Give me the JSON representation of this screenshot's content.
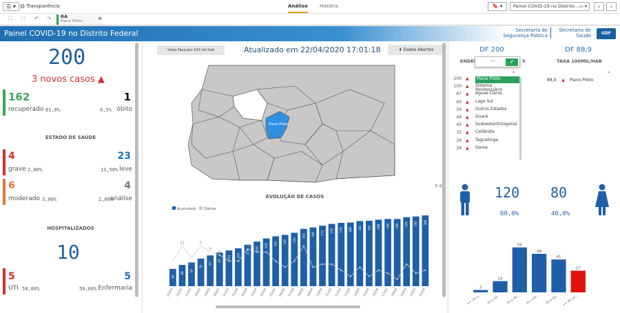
{
  "topbar": {
    "app_name": "Transparência",
    "tab_analise": "Análise",
    "tab_historia": "História",
    "sheet_title": "Painel COVID-19 no Distrito...",
    "menu_glyph": "☰ ▾",
    "bookmark_glyph": "🔖 ▾",
    "sheet_glyph": "▭ ▾",
    "prev_glyph": "‹",
    "next_glyph": "›",
    "globe_glyph": "◍"
  },
  "selection": {
    "field": "RA",
    "value": "Plano Piloto",
    "clear_glyph": "⊗",
    "tool_glyphs": [
      "⛶",
      "⬚",
      "↶",
      "↷"
    ]
  },
  "header": {
    "title": "Painel COVID-19 no Distrito Federal",
    "org1_line1": "Secretaria de",
    "org1_line2": "Segurança Pública",
    "org2_line1": "Secretaria de",
    "org2_line2": "Saúde",
    "gdf_logo": "GDF"
  },
  "left": {
    "total_cases": "200",
    "new_cases": "3 novos casos ▲",
    "recovered_value": "162",
    "recovered_label": "recuperado",
    "recovered_pct": "81,0%",
    "deaths_value": "1",
    "deaths_label": "óbito",
    "deaths_pct": "0,5%",
    "health_title": "ESTADO DE SAÚDE",
    "grave_value": "4",
    "grave_label": "grave",
    "grave_pct": "2,00%",
    "leve_value": "23",
    "leve_label": "leve",
    "leve_pct": "11,50%",
    "moderado_value": "6",
    "moderado_label": "moderado",
    "moderado_pct": "3,00%",
    "analise_value": "4",
    "analise_label": "análise",
    "analise_pct": "2,00%",
    "hosp_title": "HOSPITALIZADOS",
    "hosp_value": "10",
    "uti_value": "5",
    "uti_label": "UTI",
    "uti_pct": "50,00%",
    "enf_value": "5",
    "enf_label": "Enfermaria",
    "enf_pct": "50,00%"
  },
  "center": {
    "toggle_btn": "Visão Taxa por 100 mil hab",
    "updated": "Atualizado em 22/04/2020 17:01:18",
    "open_data_btn": "Dados Abertos",
    "download_glyph": "⬇",
    "map_label": "Plano Piloto",
    "evolution_title": "EVOLUÇÃO DE CASOS",
    "legend_acumulado": "Acumulado",
    "legend_diarios": "Diários",
    "copyright": "© Qlik"
  },
  "right": {
    "df_total": "DF 200",
    "df_rate": "DF 88,9",
    "col_endereco": "ENDER",
    "col_endereco_end": "S",
    "col_taxa": "TAXA 100MIL/HAB",
    "search_glyph": "⌕",
    "confirm_glyph": "✔",
    "more_glyph": "···",
    "list": [
      {
        "count": "200",
        "name": "Plano Piloto",
        "selected": true
      },
      {
        "count": "100",
        "name": "Sistema Penitenciário",
        "selected": false
      },
      {
        "count": "87",
        "name": "Águas Claras",
        "selected": false
      },
      {
        "count": "66",
        "name": "Lago Sul",
        "selected": false
      },
      {
        "count": "59",
        "name": "Outros Estados",
        "selected": false
      },
      {
        "count": "48",
        "name": "Guará",
        "selected": false
      },
      {
        "count": "40",
        "name": "Sudoeste/Octogonal",
        "selected": false
      },
      {
        "count": "32",
        "name": "Ceilândia",
        "selected": false
      },
      {
        "count": "26",
        "name": "Taguatinga",
        "selected": false
      },
      {
        "count": "28",
        "name": "Gama",
        "selected": false
      }
    ],
    "rate_row_value": "88,9",
    "rate_row_name": "Plano Piloto",
    "male_count": "120",
    "male_pct": "60,0%",
    "female_count": "80",
    "female_pct": "40,0%"
  },
  "chart_data": [
    {
      "type": "bar",
      "title": "EVOLUÇÃO DE CASOS",
      "series": [
        {
          "name": "Acumulado",
          "type": "bar",
          "color": "#1f5fa8",
          "values": [
            49,
            60,
            67,
            78,
            87,
            95,
            101,
            107,
            117,
            126,
            135,
            141,
            145,
            151,
            162,
            166,
            171,
            176,
            179,
            180,
            184,
            185,
            188,
            190,
            190,
            195,
            197,
            200
          ]
        },
        {
          "name": "Diários",
          "type": "line",
          "color": "#cccccc",
          "values": [
            6,
            11,
            7,
            11,
            9,
            8,
            6,
            6,
            10,
            9,
            9,
            6,
            4,
            6,
            11,
            4,
            5,
            5,
            3,
            1,
            4,
            1,
            3,
            2,
            0,
            5,
            2,
            3
          ]
        }
      ],
      "categories": [
        "25/03",
        "26/03",
        "27/03",
        "28/03",
        "29/03",
        "30/03",
        "31/03",
        "01/04",
        "02/04",
        "03/04",
        "04/04",
        "05/04",
        "06/04",
        "07/04",
        "08/04",
        "09/04",
        "10/04",
        "11/04",
        "12/04",
        "13/04",
        "14/04",
        "15/04",
        "16/04",
        "17/04",
        "18/04",
        "19/04",
        "20/04",
        "21/04",
        "22/04"
      ],
      "bar_labels": [
        "49",
        "60",
        "67",
        "78",
        "87",
        "95",
        "101",
        "107",
        "117",
        "126",
        "135",
        "141",
        "145",
        "151",
        "162",
        "166",
        "171",
        "176",
        "179",
        "180",
        "184",
        "185",
        "188",
        "190",
        "190",
        "195",
        "197",
        "200"
      ],
      "line_labels": [
        "",
        "11",
        "",
        "9",
        "9",
        "8",
        "",
        "",
        "10",
        "9",
        "",
        "",
        "",
        "",
        "",
        "",
        "",
        "",
        "",
        "",
        "",
        "",
        "",
        "",
        "",
        "",
        "",
        ""
      ]
    },
    {
      "type": "bar",
      "title": "",
      "categories": [
        "<= 18 a...",
        "20 a 29...",
        "30 a 39...",
        "40 a 49...",
        "50 a 59...",
        ">= 60 an..."
      ],
      "values": [
        3,
        14,
        56,
        48,
        41,
        27
      ],
      "colors": [
        "#1f5fa8",
        "#1f5fa8",
        "#1f5fa8",
        "#1f5fa8",
        "#1f5fa8",
        "#e01010"
      ]
    }
  ]
}
